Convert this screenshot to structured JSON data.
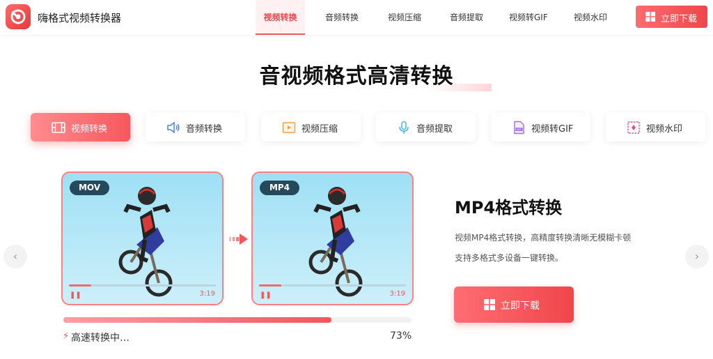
{
  "header": {
    "brand": "嗨格式视频转换器",
    "nav": [
      {
        "label": "视频转换",
        "active": true
      },
      {
        "label": "音频转换",
        "active": false
      },
      {
        "label": "视频压缩",
        "active": false
      },
      {
        "label": "音频提取",
        "active": false
      },
      {
        "label": "视频转GIF",
        "active": false
      },
      {
        "label": "视频水印",
        "active": false
      }
    ],
    "download_label": "立即下载"
  },
  "main_title": "音视频格式高清转换",
  "feature_tabs": [
    {
      "label": "视频转换",
      "icon": "film-icon",
      "active": true
    },
    {
      "label": "音频转换",
      "icon": "speaker-icon",
      "active": false
    },
    {
      "label": "视频压缩",
      "icon": "video-compress-icon",
      "active": false
    },
    {
      "label": "音频提取",
      "icon": "microphone-icon",
      "active": false
    },
    {
      "label": "视频转GIF",
      "icon": "gif-file-icon",
      "active": false
    },
    {
      "label": "视频水印",
      "icon": "watermark-icon",
      "active": false
    }
  ],
  "source_video": {
    "format": "MOV",
    "time": "3:19",
    "progress": 0.15
  },
  "target_video": {
    "format": "MP4",
    "time": "3:19",
    "progress": 0.15
  },
  "conversion": {
    "status": "高速转换中…",
    "percent_label": "73%",
    "percent": 0.77
  },
  "feature": {
    "title": "MP4格式转换",
    "desc_line1": "视频MP4格式转换，高精度转换清晰无模糊卡顿",
    "desc_line2": "支持多格式多设备一键转换。",
    "download_label": "立即下载"
  },
  "colors": {
    "accent": "#f0575c",
    "badge": "#24495a"
  }
}
